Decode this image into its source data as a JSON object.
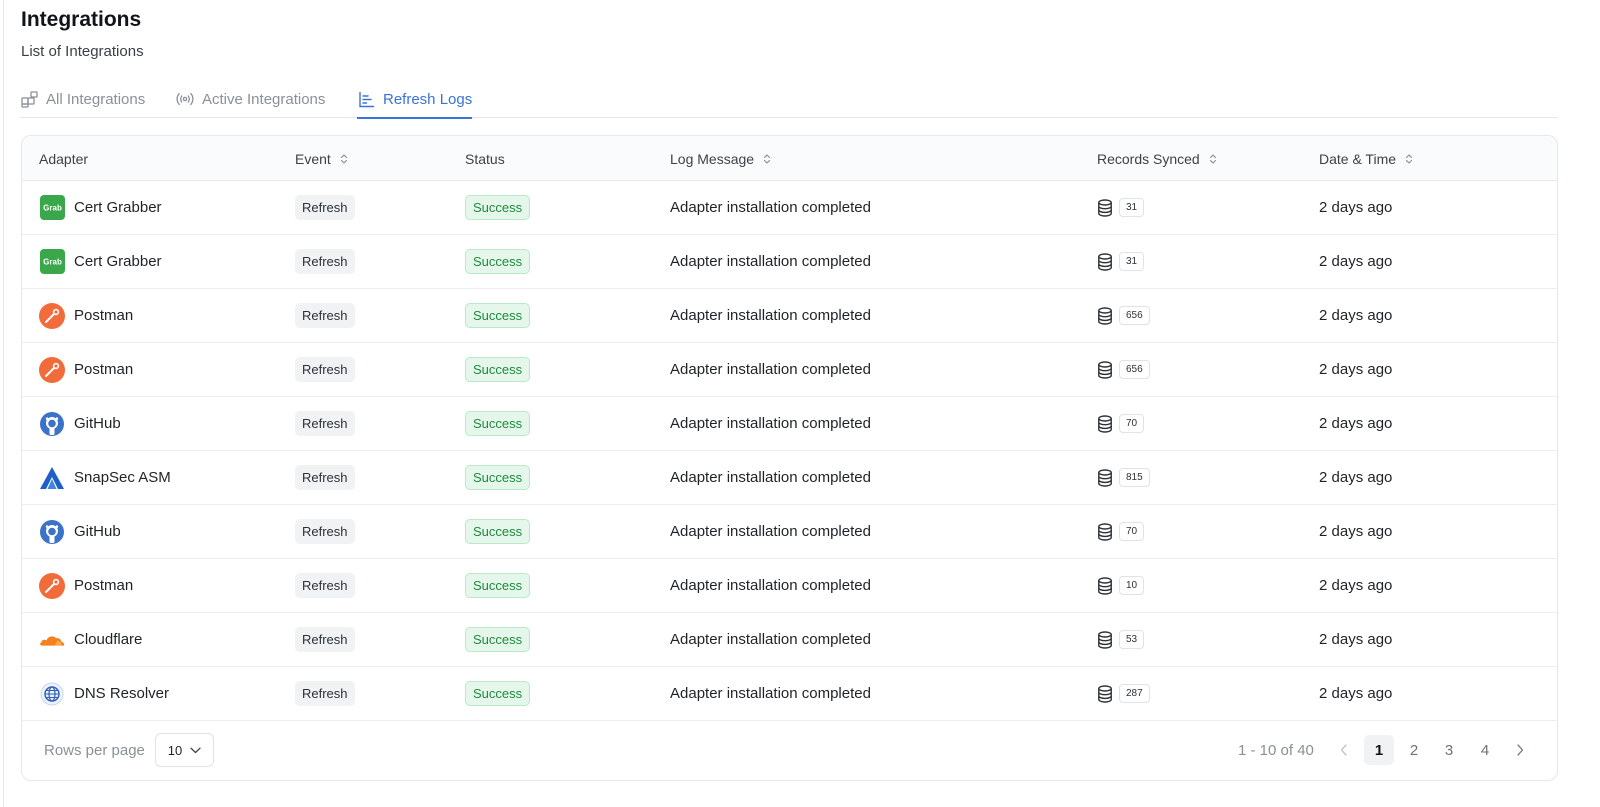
{
  "header": {
    "title": "Integrations",
    "subtitle": "List of Integrations"
  },
  "tabs": [
    {
      "label": "All Integrations",
      "icon": "grid-icon",
      "active": false
    },
    {
      "label": "Active Integrations",
      "icon": "broadcast-icon",
      "active": false
    },
    {
      "label": "Refresh Logs",
      "icon": "chart-list-icon",
      "active": true
    }
  ],
  "table": {
    "columns": {
      "adapter": "Adapter",
      "event": "Event",
      "status": "Status",
      "log_message": "Log Message",
      "records_synced": "Records Synced",
      "date_time": "Date & Time"
    },
    "rows": [
      {
        "adapter": "Cert Grabber",
        "logo": "grab-logo",
        "event": "Refresh",
        "status": "Success",
        "message": "Adapter installation completed",
        "records": "31",
        "time": "2 days ago"
      },
      {
        "adapter": "Cert Grabber",
        "logo": "grab-logo",
        "event": "Refresh",
        "status": "Success",
        "message": "Adapter installation completed",
        "records": "31",
        "time": "2 days ago"
      },
      {
        "adapter": "Postman",
        "logo": "postman-logo",
        "event": "Refresh",
        "status": "Success",
        "message": "Adapter installation completed",
        "records": "656",
        "time": "2 days ago"
      },
      {
        "adapter": "Postman",
        "logo": "postman-logo",
        "event": "Refresh",
        "status": "Success",
        "message": "Adapter installation completed",
        "records": "656",
        "time": "2 days ago"
      },
      {
        "adapter": "GitHub",
        "logo": "github-logo",
        "event": "Refresh",
        "status": "Success",
        "message": "Adapter installation completed",
        "records": "70",
        "time": "2 days ago"
      },
      {
        "adapter": "SnapSec ASM",
        "logo": "snapsec-logo",
        "event": "Refresh",
        "status": "Success",
        "message": "Adapter installation completed",
        "records": "815",
        "time": "2 days ago"
      },
      {
        "adapter": "GitHub",
        "logo": "github-logo",
        "event": "Refresh",
        "status": "Success",
        "message": "Adapter installation completed",
        "records": "70",
        "time": "2 days ago"
      },
      {
        "adapter": "Postman",
        "logo": "postman-logo",
        "event": "Refresh",
        "status": "Success",
        "message": "Adapter installation completed",
        "records": "10",
        "time": "2 days ago"
      },
      {
        "adapter": "Cloudflare",
        "logo": "cloudflare-logo",
        "event": "Refresh",
        "status": "Success",
        "message": "Adapter installation completed",
        "records": "53",
        "time": "2 days ago"
      },
      {
        "adapter": "DNS Resolver",
        "logo": "dns-resolver-logo",
        "event": "Refresh",
        "status": "Success",
        "message": "Adapter installation completed",
        "records": "287",
        "time": "2 days ago"
      }
    ]
  },
  "pagination": {
    "rows_per_page_label": "Rows per page",
    "rows_per_page": "10",
    "range": "1 - 10 of 40",
    "pages": [
      "1",
      "2",
      "3",
      "4"
    ],
    "current": "1"
  },
  "colors": {
    "accent": "#3b72d8",
    "success_bg": "#e4f7ea",
    "success_text": "#1f8a3e",
    "grab_green": "#3aa84a",
    "postman_orange": "#f26b3a",
    "github_blue": "#3b73c8",
    "snapsec_blue": "#1f5fc8",
    "cloudflare_orange": "#f48120"
  }
}
